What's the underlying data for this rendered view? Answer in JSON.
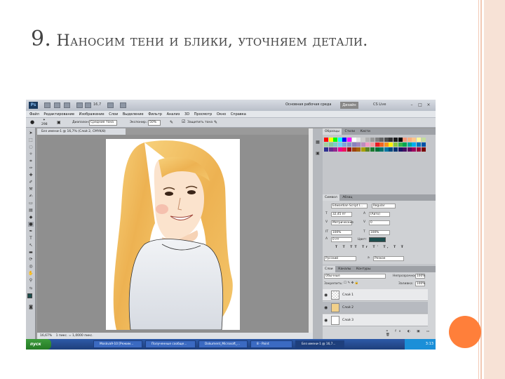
{
  "slide": {
    "title_number": "9.",
    "title_text": "Наносим тени и блики, уточняем детали."
  },
  "photoshop": {
    "logo": "Ps",
    "zoom": "16,7",
    "workspace_label": "Основная рабочая среда",
    "design_button": "Дизайн",
    "cs_live": "CS Live",
    "menu": [
      "Файл",
      "Редактирование",
      "Изображение",
      "Слои",
      "Выделение",
      "Фильтр",
      "Анализ",
      "3D",
      "Просмотр",
      "Окно",
      "Справка"
    ],
    "options": {
      "brush_size": "298",
      "range_label": "Диапазон:",
      "range_value": "Средние тона",
      "exposure_label": "Экспонир.:",
      "exposure_value": "50%",
      "protect_tones": "Защитить тона"
    },
    "document_tab": "Без имени-1 @ 16,7% (Слой 2, CMYK/8)",
    "status_zoom": "16,67%",
    "status_info": "1 пикс. = 1,0000 пикс.",
    "panels": {
      "swatch_tabs": [
        "Образцы",
        "Стили",
        "Кисти"
      ],
      "char_tabs": [
        "Символ",
        "Абзац"
      ],
      "font_family": "Edwardian Script I...",
      "font_style": "Regular",
      "font_size": "32,45 пт",
      "leading": "(Авто)",
      "kerning": "Метрические",
      "tracking": "0",
      "scale_v": "100%",
      "scale_h": "100%",
      "baseline": "0 пт",
      "color_label": "Цвет:",
      "language": "Русский",
      "antialias": "Резкое",
      "layer_tabs": [
        "Слои",
        "Каналы",
        "Контуры"
      ],
      "blend_mode": "Обычные",
      "opacity_label": "Непрозрачность:",
      "opacity_value": "100%",
      "lock_label": "Закрепить:",
      "fill_label": "Заливка:",
      "fill_value": "100%",
      "layers": [
        "Слой 1",
        "Слой 2",
        "Слой 3"
      ]
    },
    "taskbar": {
      "start": "пуск",
      "items": [
        "Moskva9-10 [Режим...",
        "Полученные сообще...",
        "Dokument_Microsoft_...",
        "8 - Paint",
        "Без имени-1 @ 16,7..."
      ],
      "time": "3:13"
    }
  },
  "colors": {
    "accent_circle": "#ff7f3a",
    "side_band": "#f7e2d6"
  }
}
